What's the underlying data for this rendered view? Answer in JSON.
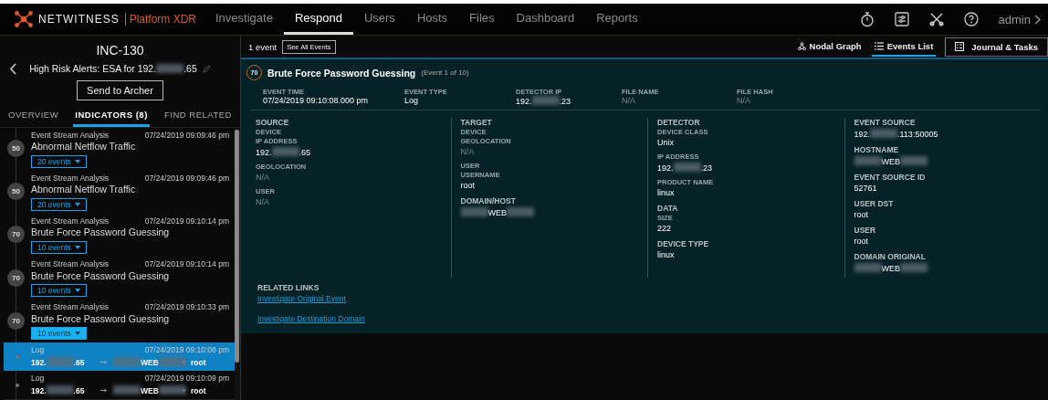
{
  "header": {
    "brand": "NETWITNESS",
    "product": "Platform XDR",
    "nav": [
      {
        "label": "Investigate",
        "selected": false
      },
      {
        "label": "Respond",
        "selected": true
      },
      {
        "label": "Users",
        "selected": false
      },
      {
        "label": "Hosts",
        "selected": false
      },
      {
        "label": "Files",
        "selected": false
      },
      {
        "label": "Dashboard",
        "selected": false
      },
      {
        "label": "Reports",
        "selected": false
      }
    ],
    "user": "admin"
  },
  "incident": {
    "id": "INC-130",
    "title_parts": [
      "High Risk Alerts: ESA for 192.",
      ".65"
    ],
    "button": "Send to Archer",
    "tabs": [
      {
        "label": "OVERVIEW",
        "selected": false
      },
      {
        "label": "INDICATORS (8)",
        "selected": true
      },
      {
        "label": "FIND RELATED",
        "selected": false
      }
    ],
    "items": [
      {
        "kind": "indicator",
        "source": "Event Stream Analysis",
        "time": "07/24/2019 09:09:46 pm",
        "score": "50",
        "name": "Abnormal Netflow Traffic",
        "events": "20 events",
        "selected": false
      },
      {
        "kind": "indicator",
        "source": "Event Stream Analysis",
        "time": "07/24/2019 09:09:46 pm",
        "score": "50",
        "name": "Abnormal Netflow Traffic",
        "events": "20 events",
        "selected": false
      },
      {
        "kind": "indicator",
        "source": "Event Stream Analysis",
        "time": "07/24/2019 09:10:14 pm",
        "score": "70",
        "name": "Brute Force Password Guessing",
        "events": "10 events",
        "selected": false
      },
      {
        "kind": "indicator",
        "source": "Event Stream Analysis",
        "time": "07/24/2019 09:10:14 pm",
        "score": "70",
        "name": "Brute Force Password Guessing",
        "events": "10 events",
        "selected": false
      },
      {
        "kind": "indicator",
        "source": "Event Stream Analysis",
        "time": "07/24/2019 09:10:33 pm",
        "score": "70",
        "name": "Brute Force Password Guessing",
        "events": "10 events",
        "selected": true
      },
      {
        "kind": "event",
        "source": "Log",
        "time": "07/24/2019 09:10:08 pm",
        "src_parts": [
          "192.",
          ".65"
        ],
        "dst_parts": [
          "WEB"
        ],
        "dst_redacted_before": true,
        "dst_redacted_after": true,
        "user": "root",
        "selected": true
      },
      {
        "kind": "event",
        "source": "Log",
        "time": "07/24/2019 09:10:09 pm",
        "src_parts": [
          "192.",
          ".65"
        ],
        "dst_parts": [
          "WEB"
        ],
        "dst_redacted_before": true,
        "dst_redacted_after": true,
        "user": "root",
        "selected": false
      }
    ]
  },
  "events": {
    "count": "1 event",
    "see_all": "See All Events",
    "views": [
      {
        "label": "Nodal Graph",
        "selected": false
      },
      {
        "label": "Events List",
        "selected": true
      }
    ],
    "journal": "Journal & Tasks",
    "event": {
      "score": "70",
      "title": "Brute Force Password Guessing",
      "subtitle": "(Event 1 of 10)",
      "summary": [
        {
          "label": "EVENT TIME",
          "value_parts": [
            "07/24/2019 09:10:08.000 pm"
          ],
          "dim": false
        },
        {
          "label": "EVENT TYPE",
          "value_parts": [
            "Log"
          ],
          "dim": false
        },
        {
          "label": "DETECTOR IP",
          "value_parts": [
            "192.",
            ".23"
          ],
          "dim": false
        },
        {
          "label": "FILE NAME",
          "value_parts": [
            "N/A"
          ],
          "dim": true
        },
        {
          "label": "FILE HASH",
          "value_parts": [
            "N/A"
          ],
          "dim": true
        }
      ],
      "columns": [
        [
          {
            "kind": "heading",
            "text": "SOURCE"
          },
          {
            "kind": "label",
            "text": "DEVICE"
          },
          {
            "kind": "label",
            "text": "IP ADDRESS"
          },
          {
            "kind": "value",
            "parts": [
              "192.",
              ".65"
            ],
            "dim": false
          },
          {
            "kind": "label",
            "text": "GEOLOCATION"
          },
          {
            "kind": "value",
            "parts": [
              "N/A"
            ],
            "dim": true
          },
          {
            "kind": "label",
            "text": "USER"
          },
          {
            "kind": "value",
            "parts": [
              "N/A"
            ],
            "dim": true
          }
        ],
        [
          {
            "kind": "heading",
            "text": "TARGET"
          },
          {
            "kind": "label",
            "text": "DEVICE"
          },
          {
            "kind": "label",
            "text": "GEOLOCATION"
          },
          {
            "kind": "value",
            "parts": [
              "N/A"
            ],
            "dim": true
          },
          {
            "kind": "label",
            "text": "USER"
          },
          {
            "kind": "label",
            "text": "USERNAME"
          },
          {
            "kind": "value",
            "parts": [
              "root"
            ],
            "dim": false
          },
          {
            "kind": "heading",
            "text": "DOMAIN/HOST"
          },
          {
            "kind": "value",
            "parts": [
              "WEB"
            ],
            "redacted_before": true,
            "redacted_after": true,
            "dim": false
          }
        ],
        [
          {
            "kind": "heading",
            "text": "DETECTOR"
          },
          {
            "kind": "label",
            "text": "DEVICE CLASS"
          },
          {
            "kind": "value",
            "parts": [
              "Unix"
            ],
            "dim": false
          },
          {
            "kind": "label",
            "text": "IP ADDRESS"
          },
          {
            "kind": "value",
            "parts": [
              "192.",
              ".23"
            ],
            "dim": false
          },
          {
            "kind": "label",
            "text": "PRODUCT NAME"
          },
          {
            "kind": "value",
            "parts": [
              "linux"
            ],
            "dim": false
          },
          {
            "kind": "heading",
            "text": "DATA"
          },
          {
            "kind": "label",
            "text": "SIZE"
          },
          {
            "kind": "value",
            "parts": [
              "222"
            ],
            "dim": false
          },
          {
            "kind": "heading",
            "text": "DEVICE TYPE"
          },
          {
            "kind": "value",
            "parts": [
              "linux"
            ],
            "dim": false
          }
        ],
        [
          {
            "kind": "heading",
            "text": "EVENT SOURCE"
          },
          {
            "kind": "value",
            "parts": [
              "192.",
              ".113:50005"
            ],
            "dim": false
          },
          {
            "kind": "heading",
            "text": "HOSTNAME"
          },
          {
            "kind": "value",
            "parts": [
              "WEB"
            ],
            "redacted_before": true,
            "redacted_after": true,
            "dim": false
          },
          {
            "kind": "heading",
            "text": "EVENT SOURCE ID"
          },
          {
            "kind": "value",
            "parts": [
              "52761"
            ],
            "dim": false
          },
          {
            "kind": "heading",
            "text": "USER DST"
          },
          {
            "kind": "value",
            "parts": [
              "root"
            ],
            "dim": false
          },
          {
            "kind": "heading",
            "text": "USER"
          },
          {
            "kind": "value",
            "parts": [
              "root"
            ],
            "dim": false
          },
          {
            "kind": "heading",
            "text": "DOMAIN ORIGINAL"
          },
          {
            "kind": "value",
            "parts": [
              "WEB"
            ],
            "redacted_before": true,
            "redacted_after": true,
            "dim": false
          }
        ]
      ],
      "related_heading": "RELATED LINKS",
      "links": [
        "Investigate Original Event",
        "Investigate Destination Domain"
      ]
    }
  }
}
